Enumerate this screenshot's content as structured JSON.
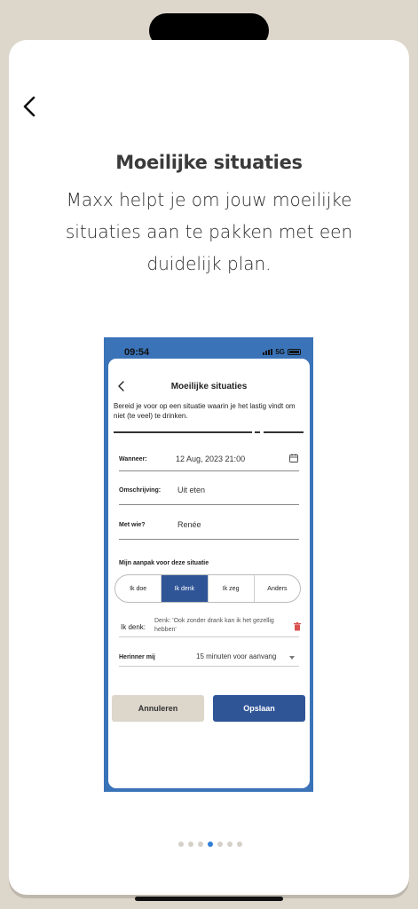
{
  "onboarding": {
    "title": "Moeilijke situaties",
    "subtitle": "Maxx helpt je om jouw moeilijke situaties aan te pakken met een duidelijk plan.",
    "page_count": 7,
    "current_page": 4
  },
  "preview": {
    "status": {
      "time": "09:54",
      "network": "5G"
    },
    "header": {
      "title": "Moeilijke situaties"
    },
    "description": "Bereid je voor op een situatie waarin je het lastig vindt om niet (te veel) te drinken.",
    "fields": {
      "when": {
        "label": "Wanneer:",
        "value": "12 Aug, 2023 21:00"
      },
      "description": {
        "label": "Omschrijving:",
        "value": "Uit eten"
      },
      "with_whom": {
        "label": "Met wie?",
        "value": "Renée"
      }
    },
    "approach": {
      "title": "Mijn aanpak voor deze situatie",
      "options": [
        "Ik doe",
        "Ik denk",
        "Ik zeg",
        "Anders"
      ],
      "selected": "Ik denk"
    },
    "think": {
      "label": "Ik denk:",
      "text": "Denk: 'Ook zonder drank kan ik het gezellig hebben'"
    },
    "reminder": {
      "label": "Herinner mij",
      "value": "15 minuten voor aanvang"
    },
    "buttons": {
      "cancel": "Annuleren",
      "save": "Opslaan"
    }
  },
  "colors": {
    "background": "#dcd6cb",
    "primary": "#2f5597",
    "preview_frame": "#3a73b8",
    "dot_active": "#2f7fd8",
    "delete": "#d9534f"
  }
}
